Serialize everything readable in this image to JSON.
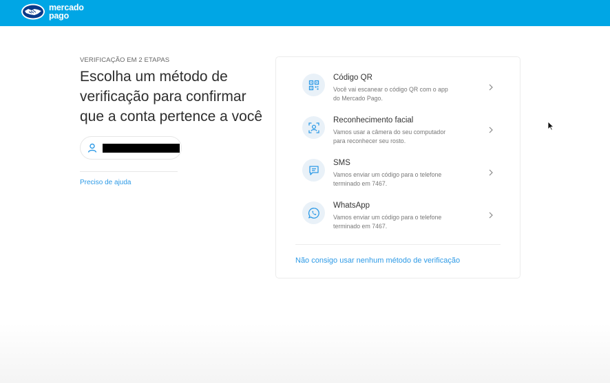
{
  "header": {
    "logo_line1": "mercado",
    "logo_line2": "pago",
    "brand_color": "#00a6e5"
  },
  "left": {
    "eyebrow": "VERIFICAÇÃO EM 2 ETAPAS",
    "title": "Escolha um método de verificação para confirmar que a conta pertence a você",
    "help_link": "Preciso de ajuda"
  },
  "methods": [
    {
      "icon": "qr-code-icon",
      "title": "Código QR",
      "desc_line1": "Você vai escanear o código QR com o app",
      "desc_line2": "do Mercado Pago."
    },
    {
      "icon": "face-scan-icon",
      "title": "Reconhecimento facial",
      "desc_line1": "Vamos usar a câmera do seu computador",
      "desc_line2": "para reconhecer seu rosto."
    },
    {
      "icon": "sms-icon",
      "title": "SMS",
      "desc_line1": "Vamos enviar um código para o telefone",
      "desc_line2": "terminado em 7467."
    },
    {
      "icon": "whatsapp-icon",
      "title": "WhatsApp",
      "desc_line1": "Vamos enviar um código para o telefone",
      "desc_line2": "terminado em 7467."
    }
  ],
  "card_link": "Não consigo usar nenhum método de verificação",
  "colors": {
    "link": "#2d9ae6",
    "icon": "#2d9ae6",
    "icon_bg": "#e9f1f8"
  }
}
